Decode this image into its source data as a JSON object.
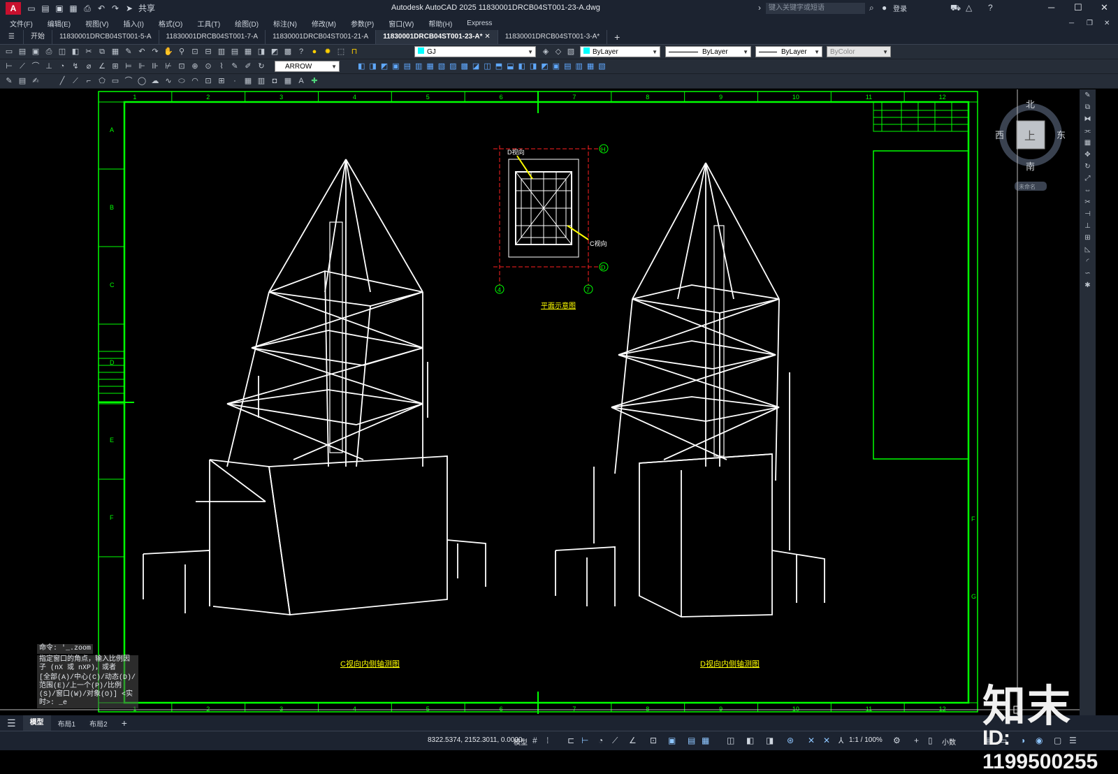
{
  "app": {
    "logo": "A",
    "title": "Autodesk AutoCAD 2025   11830001DRCB04ST001-23-A.dwg",
    "share": "共享",
    "search_placeholder": "键入关键字或短语",
    "login": "登录"
  },
  "menu": [
    "文件(F)",
    "编辑(E)",
    "视图(V)",
    "插入(I)",
    "格式(O)",
    "工具(T)",
    "绘图(D)",
    "标注(N)",
    "修改(M)",
    "参数(P)",
    "窗口(W)",
    "帮助(H)",
    "Express"
  ],
  "tabs": [
    {
      "label": "开始"
    },
    {
      "label": "11830001DRCB04ST001-5-A"
    },
    {
      "label": "11830001DRCB04ST001-7-A"
    },
    {
      "label": "11830001DRCB04ST001-21-A"
    },
    {
      "label": "11830001DRCB04ST001-23-A*",
      "active": true
    },
    {
      "label": "11830001DRCB04ST001-3-A*"
    }
  ],
  "properties": {
    "layer": "GJ",
    "color": "ByLayer",
    "linetype": "ByLayer",
    "lineweight": "ByLayer",
    "plotstyle": "ByColor",
    "dimstyle": "ARROW"
  },
  "viewcube": {
    "north": "北",
    "south": "南",
    "east": "东",
    "west": "西",
    "face": "上",
    "wcs": "未命名"
  },
  "drawing": {
    "top_numbers": [
      "1",
      "2",
      "3",
      "4",
      "5",
      "6",
      "7",
      "8",
      "9",
      "10",
      "11",
      "12"
    ],
    "left_letters": [
      "A",
      "B",
      "C",
      "D",
      "E",
      "F"
    ],
    "right_letters": [
      "F",
      "G"
    ],
    "plan_title": "平面示意图",
    "plan_axis": {
      "h": "H",
      "d": "D",
      "c4": "4",
      "c7": "7"
    },
    "plan_labels": {
      "d_view": "D视向",
      "c_view": "C视向"
    },
    "left_view_title": "C视向内侧轴测图",
    "right_view_title": "D视向内侧轴测图"
  },
  "command": {
    "history1": "命令: '_.zoom",
    "history2": "指定窗口的角点，输入比例因子 (nX 或 nXP)，或者",
    "history3": "[全部(A)/中心(C)/动态(D)/范围(E)/上一个(P)/比例(S)/窗口(W)/对象(O)] <实时>: _e"
  },
  "layout_tabs": [
    {
      "label": "模型",
      "active": true
    },
    {
      "label": "布局1"
    },
    {
      "label": "布局2"
    }
  ],
  "status": {
    "coords": "8322.5374, 2152.3011, 0.0000",
    "model": "模型",
    "scale": "1:1 / 100%",
    "units": "小数"
  },
  "watermark": {
    "logo": "知末",
    "id": "ID: 1199500255"
  },
  "colors": {
    "frame": "#00ff00",
    "plan_red": "#ff2020",
    "leader_yellow": "#ffff00",
    "title_yellow": "#ffff00"
  }
}
